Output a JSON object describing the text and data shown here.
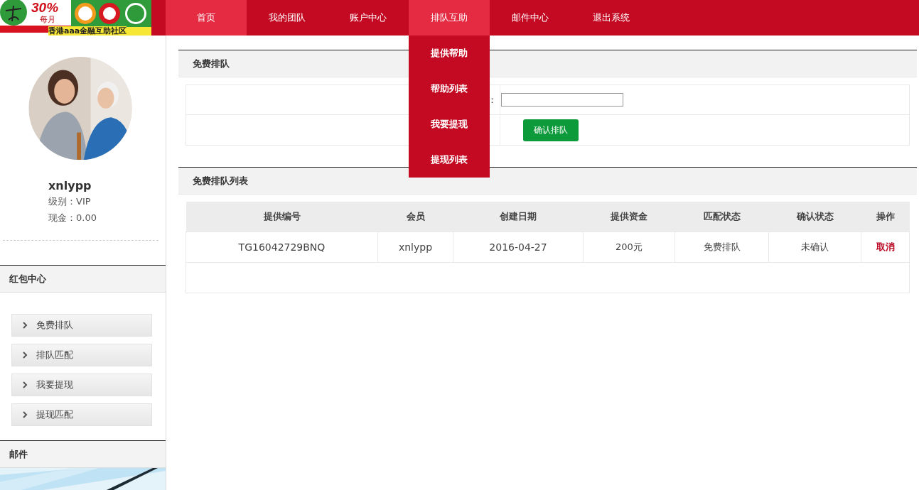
{
  "logo": {
    "badge": "30%",
    "sub": "每月",
    "caption": "香港aaa金融互助社区"
  },
  "nav": [
    {
      "label": "首页",
      "selected": true
    },
    {
      "label": "我的团队",
      "selected": false
    },
    {
      "label": "账户中心",
      "selected": false
    },
    {
      "label": "排队互助",
      "selected": true,
      "dropdown": [
        "提供帮助",
        "帮助列表",
        "我要提现",
        "提现列表"
      ]
    },
    {
      "label": "邮件中心",
      "selected": false
    },
    {
      "label": "退出系统",
      "selected": false
    }
  ],
  "profile": {
    "name": "xnlypp",
    "level": "级别：VIP",
    "cash": "现金：0.00"
  },
  "sidebar": [
    {
      "title": "红包中心",
      "items": [
        "免费排队",
        "排队匹配",
        "我要提现",
        "提现匹配"
      ]
    },
    {
      "title": "邮件"
    }
  ],
  "queue_form": {
    "title": "免费排队",
    "label": "：",
    "button": "确认排队"
  },
  "queue_list": {
    "title": "免费排队列表",
    "columns": [
      "提供编号",
      "会员",
      "创建日期",
      "提供资金",
      "匹配状态",
      "确认状态",
      "操作"
    ],
    "rows": [
      {
        "cells": [
          "TG16042729BNQ",
          "xnlypp",
          "2016-04-27",
          "200元",
          "免费排队",
          "未确认"
        ],
        "action": "取消"
      }
    ]
  }
}
